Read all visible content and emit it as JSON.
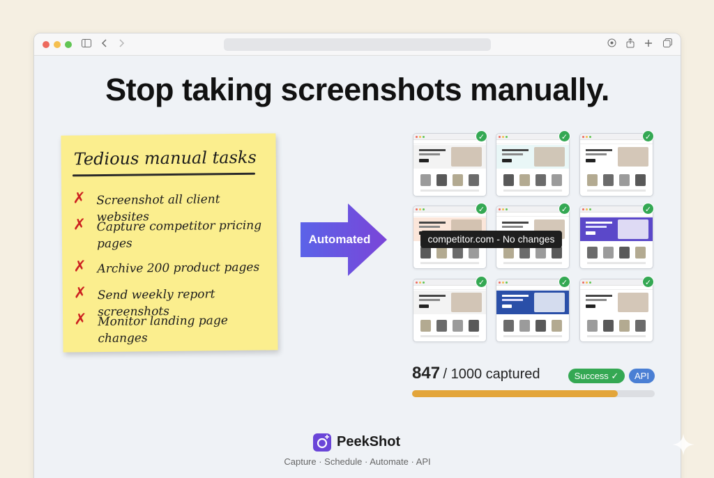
{
  "headline": "Stop taking screenshots manually.",
  "sticky_note": {
    "title": "Tedious manual tasks",
    "tasks": [
      "Screenshot all client websites",
      "Capture competitor pricing pages",
      "Archive 200 product pages",
      "Send weekly report screenshots",
      "Monitor landing page changes"
    ]
  },
  "arrow_label": "Automated",
  "tooltip": "competitor.com - No changes",
  "progress": {
    "captured": "847",
    "total_text": "/ 1000 captured",
    "fraction": 0.847
  },
  "badges": {
    "success": "Success ✓",
    "api": "API"
  },
  "brand": {
    "name": "PeekShot",
    "tagline": "Capture · Schedule · Automate · API"
  },
  "colors": {
    "accent_purple": "#6a45d8",
    "success_green": "#34a853",
    "api_blue": "#4a7fd4",
    "progress_orange": "#e3a53a",
    "sticky_yellow": "#fbee8e",
    "cross_red": "#cc2020"
  }
}
